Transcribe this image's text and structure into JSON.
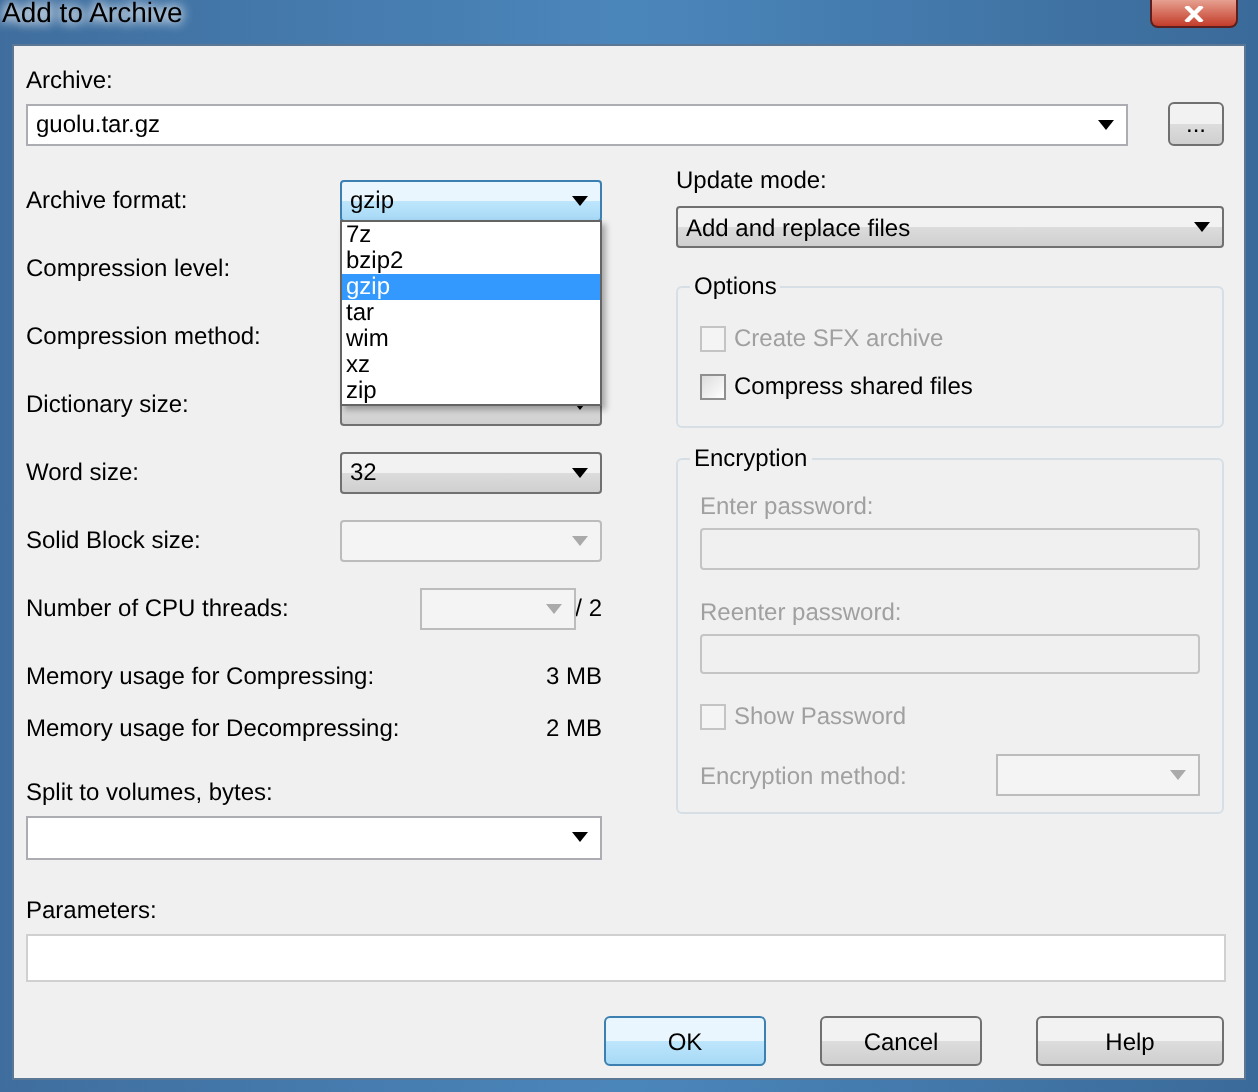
{
  "window": {
    "title": "Add to Archive"
  },
  "archive": {
    "label": "Archive:",
    "value": "guolu.tar.gz",
    "browse_button": "..."
  },
  "settings": [
    {
      "kind": "combo",
      "label": "Archive format:",
      "value": "gzip",
      "focused": true,
      "disabled": false
    },
    {
      "kind": "text",
      "label": "Compression level:"
    },
    {
      "kind": "text",
      "label": "Compression method:"
    },
    {
      "kind": "combo",
      "label": "Dictionary size:",
      "focused": false,
      "disabled": false
    },
    {
      "kind": "combo",
      "label": "Word size:",
      "value": "32",
      "focused": false,
      "disabled": false
    },
    {
      "kind": "combo",
      "label": "Solid Block size:",
      "focused": false,
      "disabled": true
    },
    {
      "kind": "threads",
      "label": "Number of CPU threads:",
      "suffix": "/ 2",
      "disabled": true
    }
  ],
  "format_dropdown": {
    "options": [
      {
        "label": "7z",
        "selected": false
      },
      {
        "label": "bzip2",
        "selected": false
      },
      {
        "label": "gzip",
        "selected": true
      },
      {
        "label": "tar",
        "selected": false
      },
      {
        "label": "wim",
        "selected": false
      },
      {
        "label": "xz",
        "selected": false
      },
      {
        "label": "zip",
        "selected": false
      }
    ]
  },
  "memory": [
    {
      "label": "Memory usage for Compressing:",
      "value": "3 MB"
    },
    {
      "label": "Memory usage for Decompressing:",
      "value": "2 MB"
    }
  ],
  "split": {
    "label": "Split to volumes, bytes:"
  },
  "parameters": {
    "label": "Parameters:"
  },
  "update_mode": {
    "label": "Update mode:",
    "value": "Add and replace files"
  },
  "options": {
    "title": "Options",
    "items": [
      {
        "label": "Create SFX archive",
        "checked": false,
        "disabled": true
      },
      {
        "label": "Compress shared files",
        "checked": false,
        "disabled": false
      }
    ]
  },
  "encryption": {
    "title": "Encryption",
    "disabled": true,
    "enter_label": "Enter password:",
    "reenter_label": "Reenter password:",
    "show_password": {
      "label": "Show Password",
      "checked": false
    },
    "method_label": "Encryption method:"
  },
  "buttons": [
    {
      "label": "OK",
      "default": true
    },
    {
      "label": "Cancel",
      "default": false
    },
    {
      "label": "Help",
      "default": false
    }
  ]
}
